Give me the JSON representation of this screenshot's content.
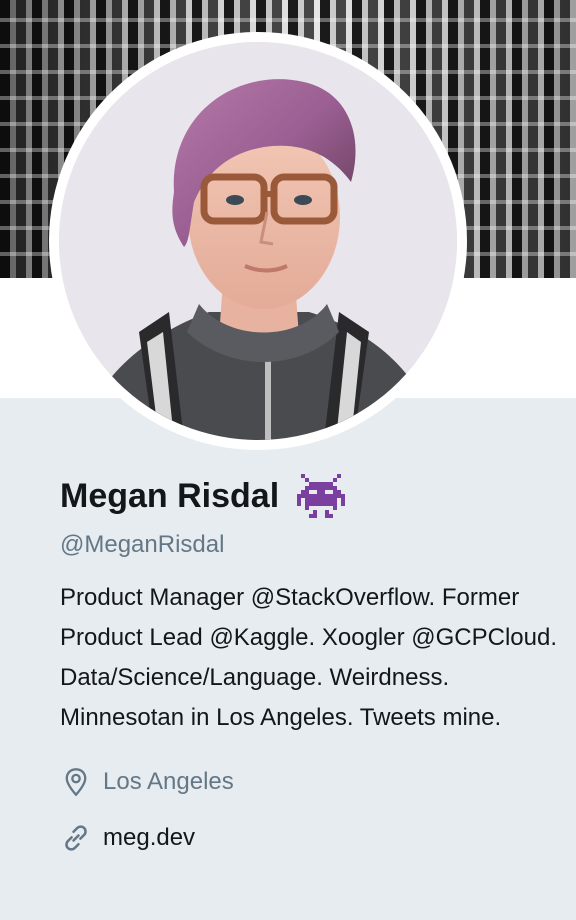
{
  "profile": {
    "name": "Megan Risdal",
    "name_emoji": "alien-monster-icon",
    "handle": "@MeganRisdal",
    "bio": "Product Manager @StackOverflow. Former Product Lead @Kaggle. Xoogler @GCPCloud. Data/Science/Language. Weirdness. Minnesotan in Los Angeles. Tweets mine.",
    "location": "Los Angeles",
    "website": "meg.dev"
  },
  "colors": {
    "background": "#e6ecf0",
    "name": "#14171a",
    "secondary": "#657786",
    "emoji": "#7b3fa0"
  }
}
